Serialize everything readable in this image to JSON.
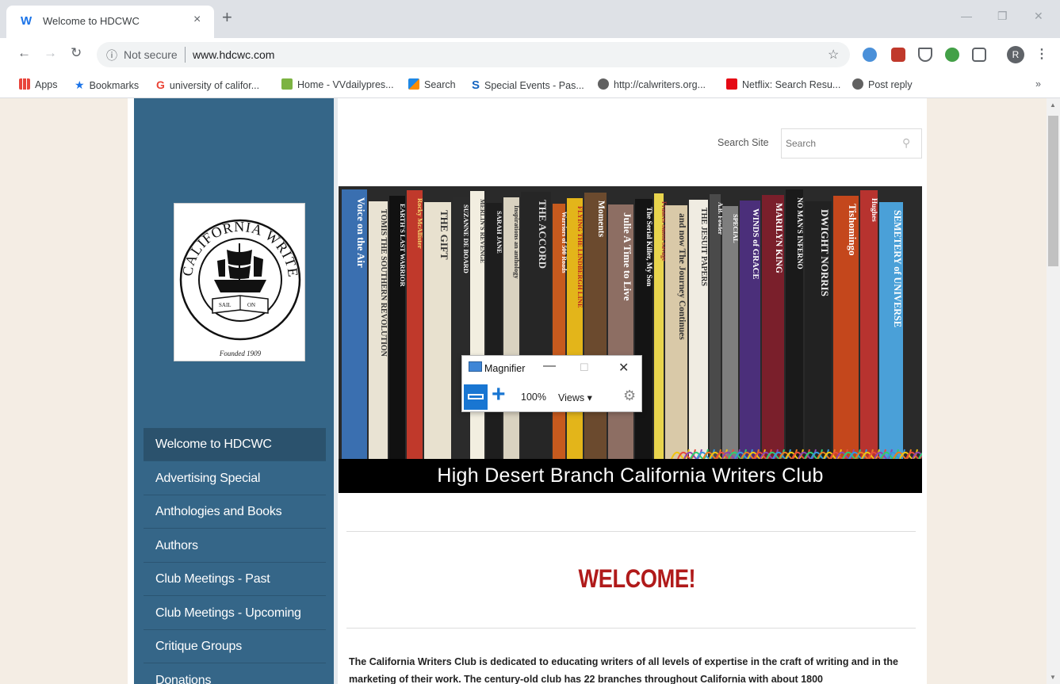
{
  "browser": {
    "tab_title": "Welcome to HDCWC",
    "tab_close": "×",
    "new_tab": "+",
    "not_secure": "Not secure",
    "url": "www.hdcwc.com",
    "avatar_letter": "R",
    "bookmarks": [
      {
        "label": "Apps",
        "icon": "apps-grid-icon",
        "color": "#e8453c"
      },
      {
        "label": "Bookmarks",
        "icon": "star-icon",
        "color": "#1a73e8"
      },
      {
        "label": "university of califor...",
        "icon": "google-icon",
        "color": "#ea4335"
      },
      {
        "label": "Home - VVdailypres...",
        "icon": "palm-icon",
        "color": "#7cb342"
      },
      {
        "label": "Search",
        "icon": "search-logo-icon",
        "color": "#1e88e5"
      },
      {
        "label": "Special Events - Pas...",
        "icon": "s-logo-icon",
        "color": "#1565c0"
      },
      {
        "label": "http://calwriters.org...",
        "icon": "globe-icon",
        "color": "#616161"
      },
      {
        "label": "Netflix: Search Resu...",
        "icon": "netflix-icon",
        "color": "#e50914"
      },
      {
        "label": "Post reply",
        "icon": "globe-icon",
        "color": "#616161"
      }
    ],
    "bookmarks_overflow": "»"
  },
  "site": {
    "search_label": "Search Site",
    "search_placeholder": "Search",
    "logo": {
      "ring_text": "CALIFORNIA WRITERS CLUB",
      "book_text_left": "SAIL",
      "book_text_right": "ON",
      "founded": "Founded 1909"
    },
    "nav": [
      "Welcome to HDCWC",
      "Advertising Special",
      "Anthologies and Books",
      "Authors",
      "Club Meetings - Past",
      "Club Meetings - Upcoming",
      "Critique Groups",
      "Donations"
    ],
    "banner_caption": "High Desert Branch California Writers Club",
    "book_spines": [
      "Voice on the Air",
      "TOMIS THE SOUTHERN REVOLUTION",
      "EARTH'S LAST WARRIOR",
      "Rocky McAllister",
      "THE GIFT",
      "SUZANNE DE BOARD",
      "MERLIN'S REVENGE",
      "SARAH JANE",
      "Inspirations an anthology",
      "THE ACCORD",
      "Warriors of 500 Roads",
      "FLYING THE LINDBERGH LINE",
      "Moments",
      "Julie A Time to Live",
      "The Serial Killer, My Son",
      "Frances Smith Savage",
      "and now The Journey Continues",
      "THE JESUIT PAPERS",
      "A.B. Fowler",
      "SPECIAL",
      "WINDS of GRACE",
      "MARILYN KING",
      "NO MAN'S INFERNO",
      "DWIGHT NORRIS",
      "Tishomingo",
      "Hughes",
      "SEMETERY of UNIVERSE"
    ],
    "welcome": "WELCOME!",
    "intro": "The California Writers Club is dedicated to educating writers of all levels of expertise in the craft of writing and in the marketing of their work.  The century-old club has 22 branches throughout California with about 1800"
  },
  "magnifier": {
    "title": "Magnifier",
    "zoom": "100%",
    "views": "Views ▾"
  }
}
